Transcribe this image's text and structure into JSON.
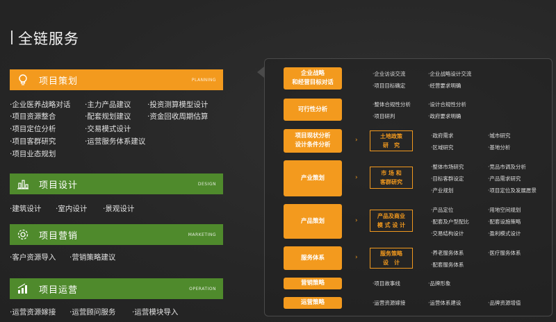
{
  "page": {
    "title": "全链服务"
  },
  "categories": [
    {
      "name": "项目策划",
      "en": "PLANNING",
      "icon": "lightbulb-icon",
      "color": "#f39a1e",
      "items": [
        "·企业医养战略对话",
        "·项目资源整合",
        "·项目定位分析",
        "·项目客群研究",
        "·项目业态规划",
        "·主力产品建议",
        "·配套规划建议",
        "·交易模式设计",
        "·运营服务体系建议",
        "·投资测算模型设计",
        "·资金回收周期估算"
      ]
    },
    {
      "name": "项目设计",
      "en": "DESIGN",
      "icon": "building-chart-icon",
      "color": "#4f8a2c",
      "items": [
        "·建筑设计",
        "·室内设计",
        "·景观设计"
      ]
    },
    {
      "name": "项目营销",
      "en": "MARKETING",
      "icon": "gear-icon",
      "color": "#4f8a2c",
      "items": [
        "·客户资源导入",
        "·营销策略建议"
      ]
    },
    {
      "name": "项目运营",
      "en": "OPERATION",
      "icon": "bar-chart-icon",
      "color": "#4f8a2c",
      "items": [
        "·运营资源嫁接",
        "·运营顾问服务",
        "·运营模块导入"
      ]
    }
  ],
  "flow": {
    "chevron": "›",
    "rows": [
      {
        "label": [
          "企业战略",
          "和经营目标对话"
        ],
        "bullets": [
          "·企业访谈交流",
          "·企业战略设计交流",
          "·项目目标确定",
          "·经营要求明确"
        ]
      },
      {
        "label": [
          "可行性分析"
        ],
        "bullets": [
          "·整体合规性分析",
          "·设计合规性分析",
          "·项目研判",
          "·政府要求明确"
        ]
      },
      {
        "label": [
          "项目现状分析",
          "设计条件分析"
        ],
        "sub": [
          "土地政策",
          "研　究"
        ],
        "bullets": [
          "·政府需求",
          "·城市研究",
          "·区域研究",
          "·基地分析"
        ]
      },
      {
        "label": [
          "产业策划"
        ],
        "sub": [
          "市 场 和",
          "客群研究"
        ],
        "bullets": [
          "·整体市场研究",
          "·竞品市调及分析",
          "·目标客群设定",
          "·产品需求研究",
          "·产业规划",
          "·项目定位及发展愿景"
        ]
      },
      {
        "label": [
          "产品策划"
        ],
        "sub": [
          "产品及商业",
          "模 式 设 计"
        ],
        "bullets": [
          "·产品定位",
          "·用地空间规划",
          "·配套及户型配比",
          "·配套设施策略",
          "·交易结构设计",
          "·盈利模式设计"
        ]
      },
      {
        "label": [
          "服务体系"
        ],
        "sub": [
          "服务策略",
          "设　计"
        ],
        "bullets": [
          "·养老服务体系",
          "·医疗服务体系",
          "·配套服务体系"
        ]
      },
      {
        "label": [
          "营销策略"
        ],
        "bullets": [
          "·项目故事线",
          "·品牌形象"
        ]
      },
      {
        "label": [
          "运营策略"
        ],
        "bullets": [
          "·运营资源嫁接",
          "·运营体系建设",
          "·品牌资源增值"
        ]
      }
    ]
  }
}
